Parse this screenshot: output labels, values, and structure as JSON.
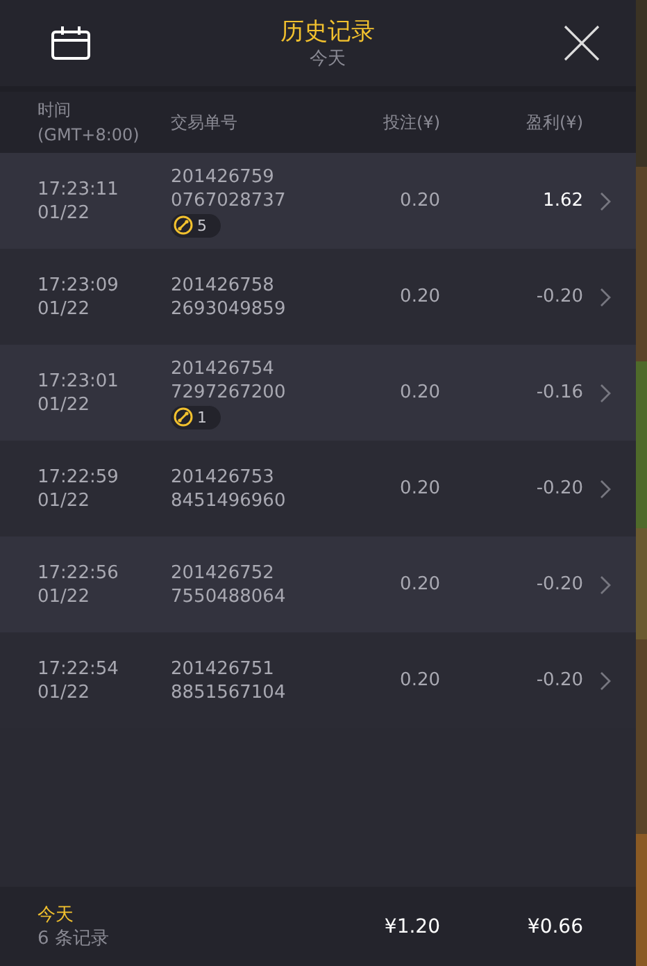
{
  "header": {
    "title": "历史记录",
    "subtitle": "今天"
  },
  "columns": [
    {
      "line1": "时间",
      "line2": "(GMT+8:00)"
    },
    {
      "line1": "交易单号"
    },
    {
      "line1": "投注(¥)"
    },
    {
      "line1": "盈利(¥)"
    }
  ],
  "rows": [
    {
      "time": "17:23:11",
      "date": "01/22",
      "order1": "201426759",
      "order2": "0767028737",
      "badge": "5",
      "stake": "0.20",
      "profit": "1.62",
      "positive": true
    },
    {
      "time": "17:23:09",
      "date": "01/22",
      "order1": "201426758",
      "order2": "2693049859",
      "stake": "0.20",
      "profit": "-0.20",
      "positive": false
    },
    {
      "time": "17:23:01",
      "date": "01/22",
      "order1": "201426754",
      "order2": "7297267200",
      "badge": "1",
      "stake": "0.20",
      "profit": "-0.16",
      "positive": false
    },
    {
      "time": "17:22:59",
      "date": "01/22",
      "order1": "201426753",
      "order2": "8451496960",
      "stake": "0.20",
      "profit": "-0.20",
      "positive": false
    },
    {
      "time": "17:22:56",
      "date": "01/22",
      "order1": "201426752",
      "order2": "7550488064",
      "stake": "0.20",
      "profit": "-0.20",
      "positive": false
    },
    {
      "time": "17:22:54",
      "date": "01/22",
      "order1": "201426751",
      "order2": "8851567104",
      "stake": "0.20",
      "profit": "-0.20",
      "positive": false
    }
  ],
  "footer": {
    "period": "今天",
    "count": "6 条记录",
    "total_stake": "¥1.20",
    "total_profit": "¥0.66"
  }
}
